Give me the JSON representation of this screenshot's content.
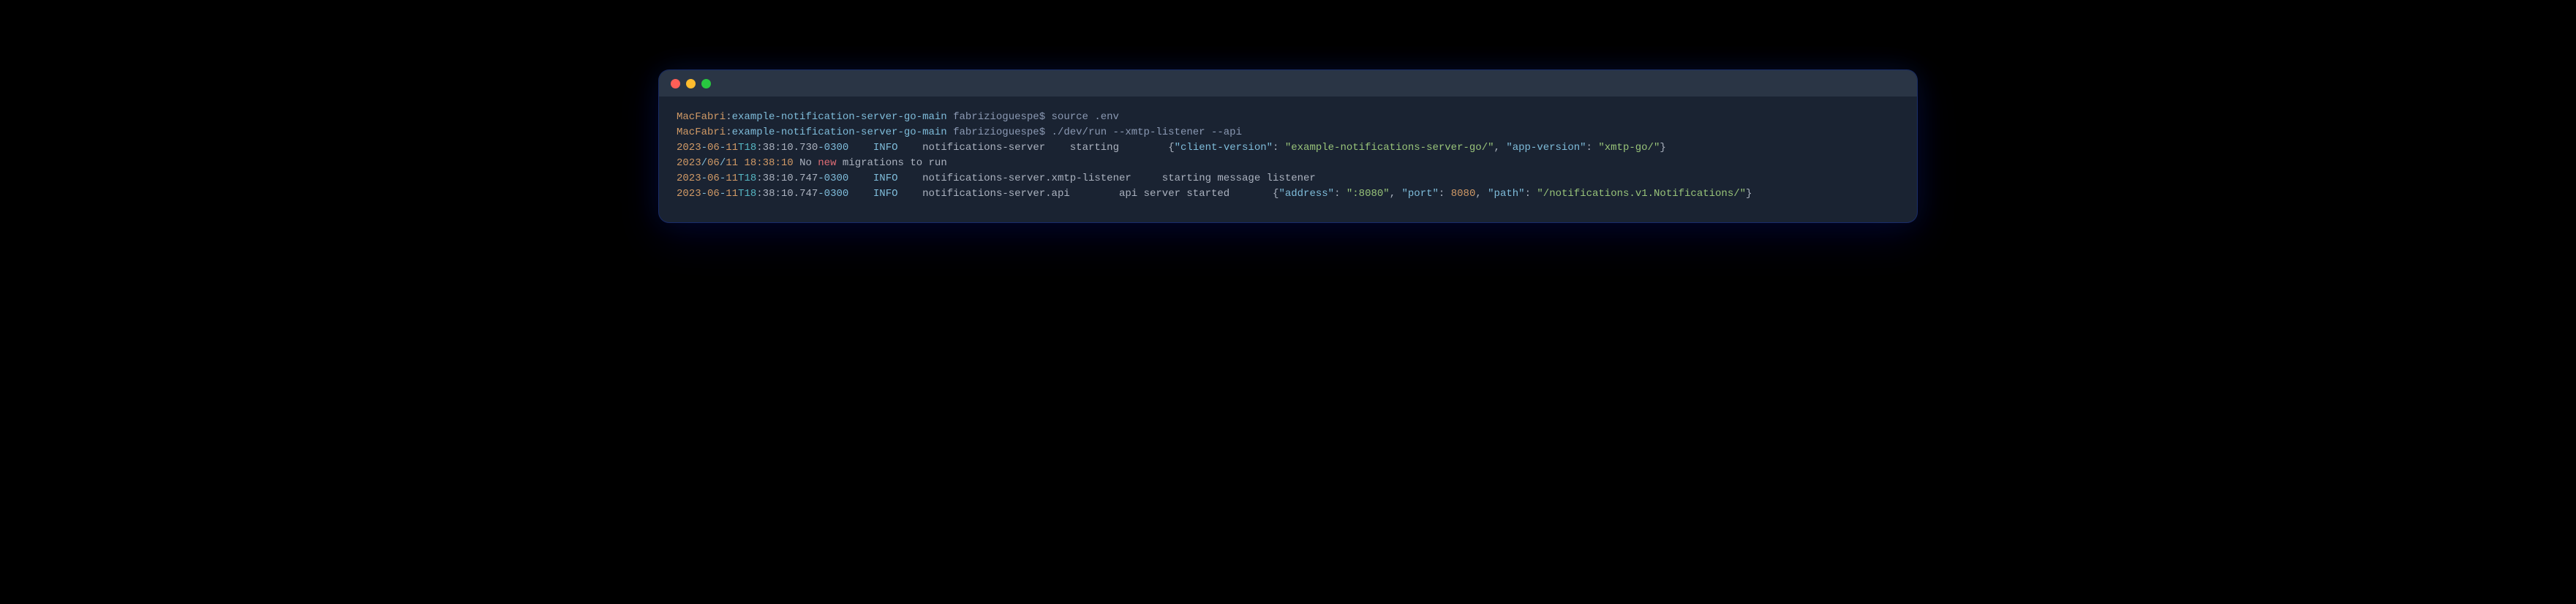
{
  "prompt": {
    "host": "MacFabri",
    "colon": ":",
    "path": "example-notification-server-go-main",
    "user": "fabrizioguespe$"
  },
  "commands": {
    "cmd1": "source .env",
    "cmd2": "./dev/run --xmtp-listener --api"
  },
  "lines": {
    "l3": {
      "date_prefix": "2023",
      "dash": "-",
      "month": "06",
      "day": "11",
      "t": "T18",
      "time_rest": ":38:10.730",
      "tz": "-0300",
      "level": "INFO",
      "logger": "notifications-server",
      "msg": "starting",
      "json_open": "{",
      "k1": "\"client-version\"",
      "sep": ": ",
      "v1": "\"example-notifications-server-go/\"",
      "comma": ", ",
      "k2": "\"app-version\"",
      "v2": "\"xmtp-go/\"",
      "json_close": "}"
    },
    "l4": {
      "date": "2023",
      "slash": "/",
      "month": "06",
      "day": "11",
      "space": " ",
      "time": "18:38:10",
      "no": " No ",
      "new": "new",
      "rest": " migrations to run"
    },
    "l5": {
      "date_prefix": "2023",
      "dash": "-",
      "month": "06",
      "day": "11",
      "t": "T18",
      "time_rest": ":38:10.747",
      "tz": "-0300",
      "level": "INFO",
      "logger": "notifications-server.xmtp-listener",
      "msg": "starting message listener"
    },
    "l6": {
      "date_prefix": "2023",
      "dash": "-",
      "month": "06",
      "day": "11",
      "t": "T18",
      "time_rest": ":38:10.747",
      "tz": "-0300",
      "level": "INFO",
      "logger": "notifications-server.api",
      "msg": "api server started",
      "json_open": "{",
      "k1": "\"address\"",
      "sep": ": ",
      "v1": "\":8080\"",
      "comma": ", ",
      "k2": "\"port\"",
      "v2num": "8080",
      "k3": "\"path\"",
      "v3": "\"/notifications.v1.Notifications/\"",
      "json_close": "}"
    }
  },
  "spacing": {
    "s4": "    ",
    "s5": "     ",
    "s7": "       ",
    "s8": "        ",
    "s9": "         "
  }
}
